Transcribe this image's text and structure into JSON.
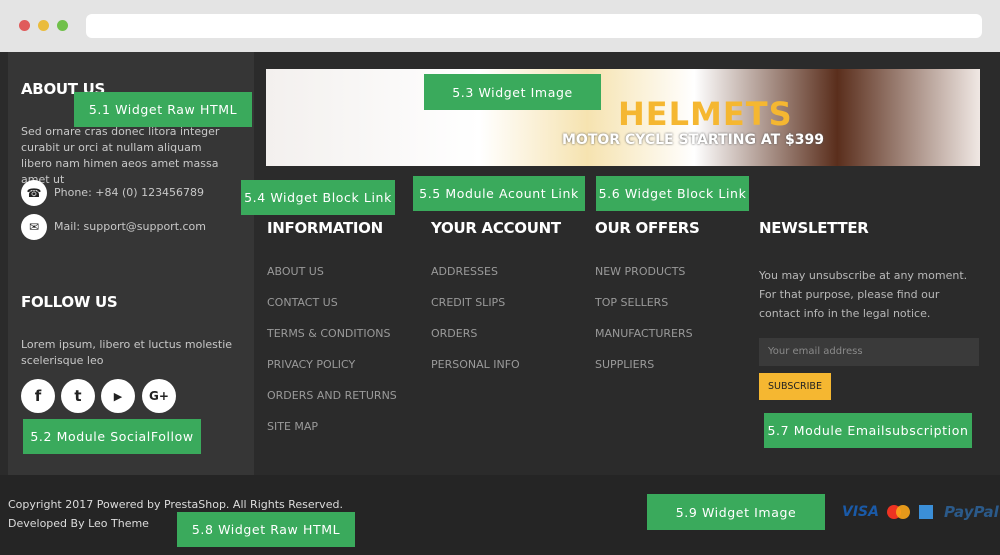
{
  "colors": {
    "accent": "#3aaa5c",
    "subscribe": "#f5b731",
    "helmets": "#f5b731"
  },
  "about": {
    "title": "ABOUT US",
    "text": "Sed ornare cras donec litora integer curabit ur orci at nullam aliquam libero nam himen aeos amet massa amet ut",
    "phone": "Phone: +84 (0) 123456789",
    "mail": "Mail: support@support.com",
    "phone_icon": "phone-icon",
    "mail_icon": "envelope-icon"
  },
  "follow": {
    "title": "FOLLOW US",
    "text": "Lorem ipsum, libero et luctus molestie scelerisque leo",
    "icons": [
      "facebook-icon",
      "twitter-icon",
      "youtube-icon",
      "google-plus-icon"
    ],
    "glyphs": [
      "f",
      "t",
      "▶",
      "G+"
    ]
  },
  "banner": {
    "title": "HELMETS",
    "subtitle": "MOTOR CYCLE STARTING AT $399"
  },
  "columns": [
    {
      "title": "INFORMATION",
      "links": [
        "ABOUT US",
        "CONTACT US",
        "TERMS & CONDITIONS",
        "PRIVACY POLICY",
        "ORDERS AND RETURNS",
        "SITE MAP"
      ]
    },
    {
      "title": "YOUR ACCOUNT",
      "links": [
        "ADDRESSES",
        "CREDIT SLIPS",
        "ORDERS",
        "PERSONAL INFO"
      ]
    },
    {
      "title": "OUR OFFERS",
      "links": [
        "NEW PRODUCTS",
        "TOP SELLERS",
        "MANUFACTURERS",
        "SUPPLIERS"
      ]
    }
  ],
  "newsletter": {
    "title": "NEWSLETTER",
    "text": "You may unsubscribe at any moment. For that purpose, please find our contact info in the legal notice.",
    "placeholder": "Your email address",
    "button": "SUBSCRIBE"
  },
  "bottom": {
    "copyright": "Copyright 2017 Powered by PrestaShop. All Rights Reserved.",
    "developed": "Developed By Leo Theme",
    "payments": [
      "VISA",
      "MasterCard",
      "AmEx",
      "PayPal"
    ]
  },
  "labels": [
    "5.1 Widget Raw HTML",
    "5.2 Module SocialFollow",
    "5.3 Widget Image",
    "5.4 Widget Block Link",
    "5.5 Module Acount Link",
    "5.6 Widget Block Link",
    "5.7 Module Emailsubscription",
    "5.8 Widget Raw HTML",
    "5.9 Widget Image"
  ]
}
